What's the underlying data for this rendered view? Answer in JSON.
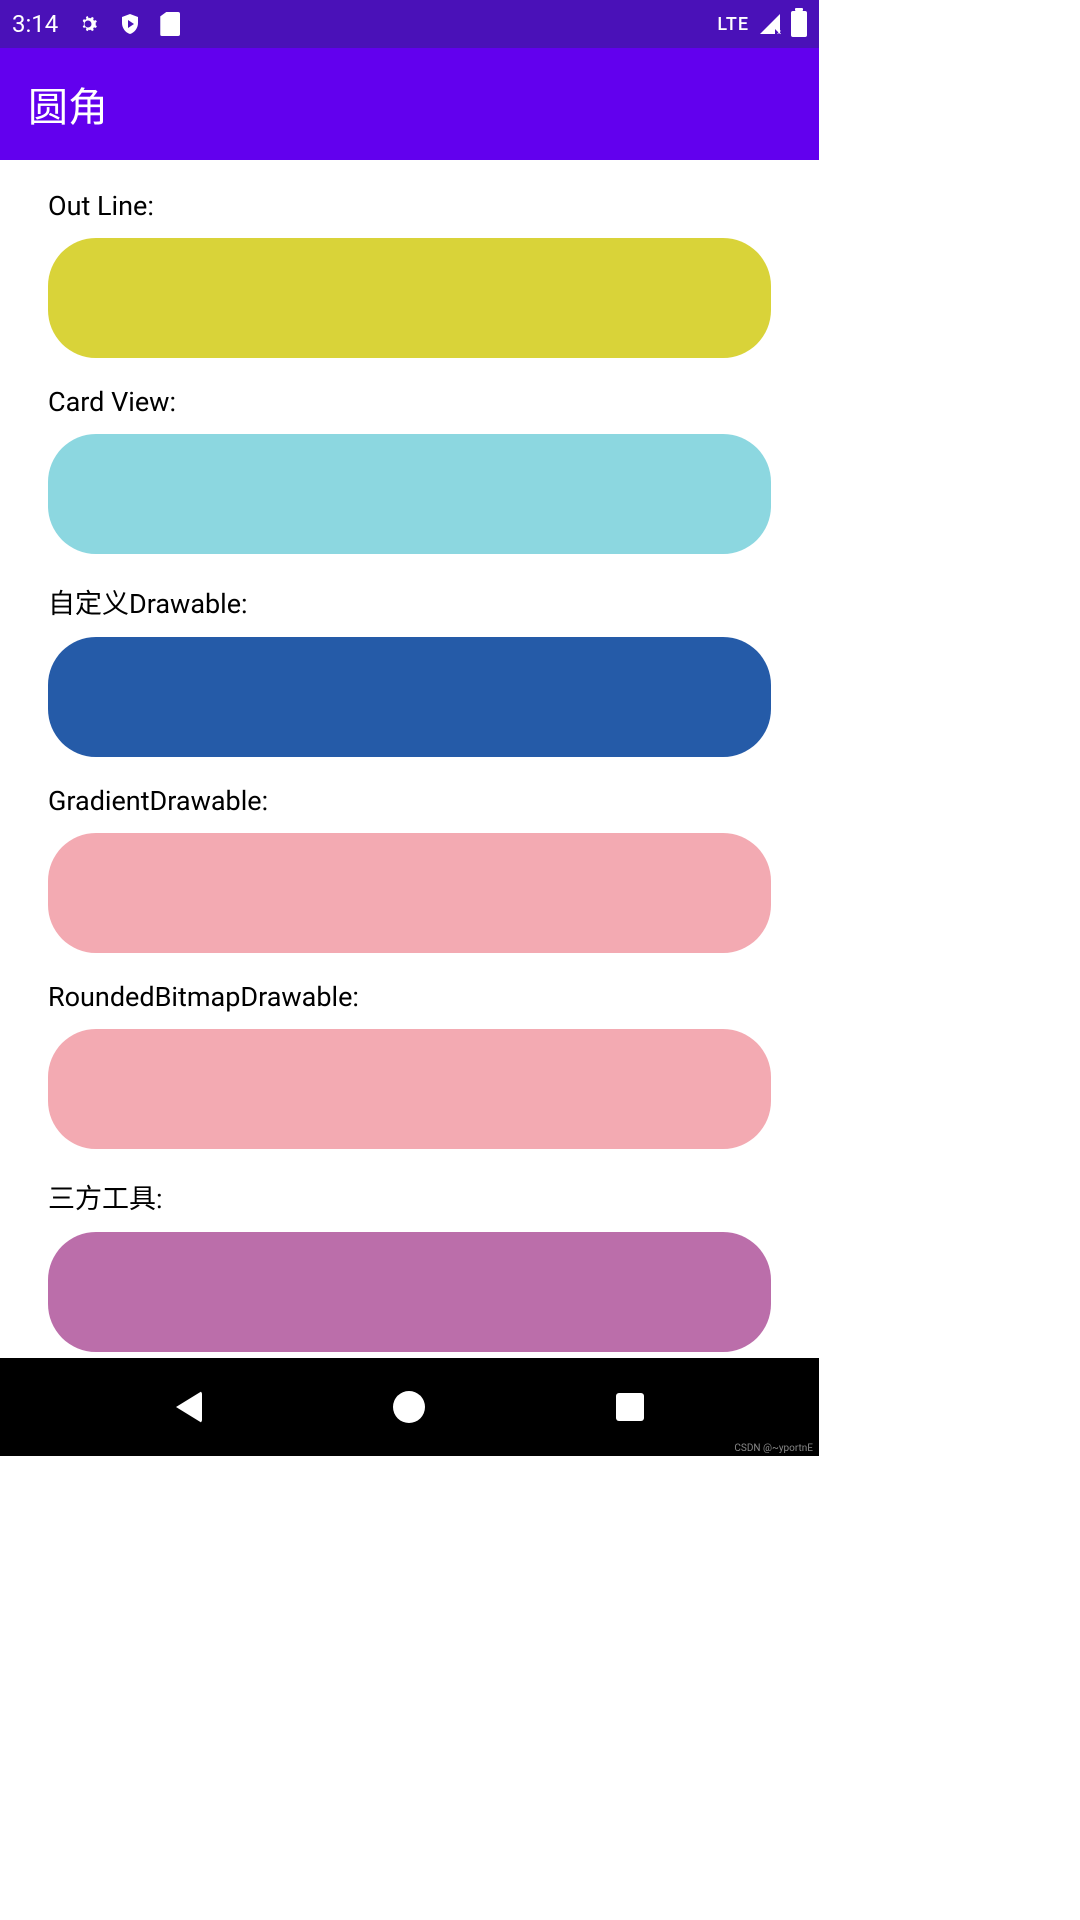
{
  "statusBar": {
    "time": "3:14",
    "networkLabel": "LTE"
  },
  "appBar": {
    "title": "圆角"
  },
  "sections": [
    {
      "label": "Out Line:",
      "colorClass": "box-yellow",
      "name": "outline-box"
    },
    {
      "label": "Card View:",
      "colorClass": "box-cyan",
      "name": "cardview-box"
    },
    {
      "label": "自定义Drawable:",
      "colorClass": "box-blue",
      "name": "custom-drawable-box"
    },
    {
      "label": "GradientDrawable:",
      "colorClass": "box-pink",
      "name": "gradient-drawable-box"
    },
    {
      "label": "RoundedBitmapDrawable:",
      "colorClass": "box-pink",
      "name": "rounded-bitmap-drawable-box"
    },
    {
      "label": "三方工具:",
      "colorClass": "box-purple",
      "name": "third-party-box"
    }
  ],
  "watermark": "CSDN @~yportnE"
}
